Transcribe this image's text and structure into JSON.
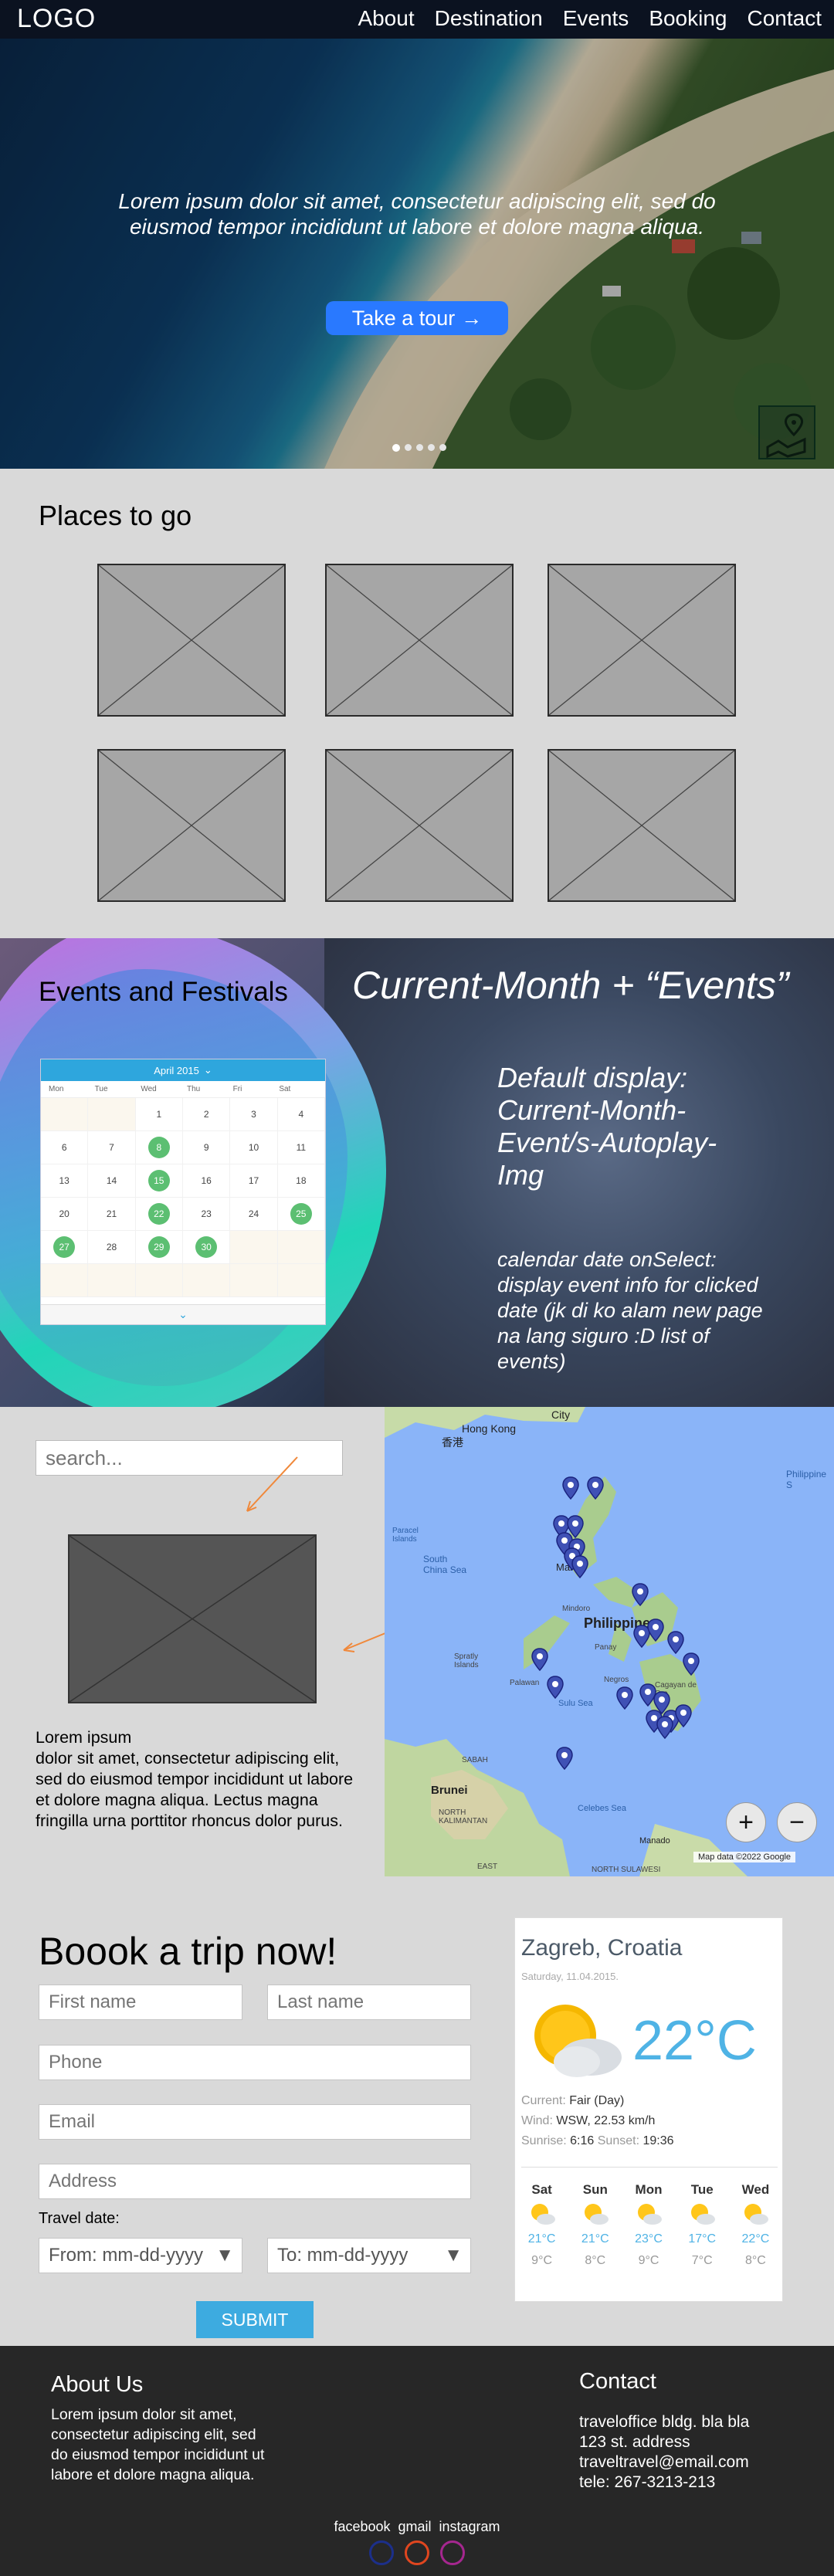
{
  "nav": {
    "logo": "LOGO",
    "links": [
      "About",
      "Destination",
      "Events",
      "Booking",
      "Contact"
    ]
  },
  "hero": {
    "text": "Lorem ipsum dolor sit amet, consectetur adipiscing elit, sed do eiusmod tempor incididunt ut labore et dolore magna aliqua.",
    "button_label": "Take a tour",
    "button_icon": "arrow-right-icon",
    "slide_count": 5,
    "active_slide": 1,
    "map_button_icon": "map-location-icon"
  },
  "places": {
    "title": "Places to go",
    "tile_count": 6
  },
  "events": {
    "title": "Events and Festivals",
    "month_heading": "Current-Month + “Events”",
    "default_display": "Default display: Current-Month-Event/s-Autoplay-Img",
    "calendar_note": "calendar date onSelect: display event info for clicked date (jk di ko alam new page na lang siguro :D list of events)",
    "calendar": {
      "header": "April 2015",
      "weekdays": [
        "Mon",
        "Tue",
        "Wed",
        "Thu",
        "Fri",
        "Sat"
      ],
      "weeks": [
        [
          "",
          "",
          "1",
          "2",
          "3",
          "4"
        ],
        [
          "6",
          "7",
          "8",
          "9",
          "10",
          "11"
        ],
        [
          "13",
          "14",
          "15",
          "16",
          "17",
          "18"
        ],
        [
          "20",
          "21",
          "22",
          "23",
          "24",
          "25"
        ],
        [
          "27",
          "28",
          "29",
          "30",
          "",
          ""
        ],
        [
          "",
          "",
          "",
          "",
          "",
          ""
        ]
      ],
      "highlighted": [
        "8",
        "15",
        "22",
        "25",
        "27",
        "29",
        "30"
      ],
      "accent_color": "#5cbf72",
      "header_color": "#2ea6dd"
    }
  },
  "map_section": {
    "search_placeholder": "search...",
    "info_text": "Lorem ipsum\ndolor sit amet, consectetur adipiscing elit, sed do eiusmod tempor incididunt ut labore et dolore magna aliqua. Lectus magna fringilla urna porttitor rhoncus dolor purus.",
    "map_labels": {
      "hong_kong": "Hong Kong",
      "hong_kong_cn": "香港",
      "city": "City",
      "paracel": "Paracel Islands",
      "scs": "South China Sea",
      "manila": "Manila",
      "philippines": "Philippines",
      "philippine_sea": "Philippine S",
      "mindoro": "Mindoro",
      "panay": "Panay",
      "spratly": "Spratly Islands",
      "palawan": "Palawan",
      "negros": "Negros",
      "cagayan": "Cagayan de Oro",
      "sulu": "Sulu Sea",
      "sabah": "SABAH",
      "brunei": "Brunei",
      "north_kalimantan": "NORTH KALIMANTAN",
      "celebes": "Celebes Sea",
      "manado": "Manado",
      "east": "EAST",
      "north_sulawesi": "NORTH SULAWESI",
      "attribution": "Map data ©2022 Google"
    },
    "zoom_in": "+",
    "zoom_out": "−"
  },
  "booking": {
    "title": "Boook a trip now!",
    "first_name": "First name",
    "last_name": "Last name",
    "phone": "Phone",
    "email": "Email",
    "address": "Address",
    "travel_date_label": "Travel date:",
    "from_placeholder": "From: mm-dd-yyyy",
    "to_placeholder": "To: mm-dd-yyyy",
    "submit_label": "SUBMIT"
  },
  "weather": {
    "city": "Zagreb, Croatia",
    "date": "Saturday, 11.04.2015.",
    "temperature": "22°C",
    "current_label": "Current:",
    "current_value": "Fair (Day)",
    "wind_label": "Wind:",
    "wind_value": "WSW, 22.53 km/h",
    "sunrise_label": "Sunrise:",
    "sunrise_value": "6:16",
    "sunset_label": "Sunset:",
    "sunset_value": "19:36",
    "icon": "sun-cloud-icon",
    "forecast": [
      {
        "day": "Sat",
        "hi": "21°C",
        "lo": "9°C"
      },
      {
        "day": "Sun",
        "hi": "21°C",
        "lo": "8°C"
      },
      {
        "day": "Mon",
        "hi": "23°C",
        "lo": "9°C"
      },
      {
        "day": "Tue",
        "hi": "17°C",
        "lo": "7°C"
      },
      {
        "day": "Wed",
        "hi": "22°C",
        "lo": "8°C"
      }
    ]
  },
  "footer": {
    "about_title": "About Us",
    "about_text": "Lorem ipsum dolor sit amet, consectetur adipiscing elit, sed do eiusmod tempor incididunt ut labore et dolore magna aliqua.",
    "contact_title": "Contact",
    "contact_lines": [
      "traveloffice bldg. bla bla",
      "123 st. address",
      "traveltravel@email.com",
      "tele: 267-3213-213"
    ],
    "social": [
      "facebook",
      "gmail",
      "instagram"
    ],
    "social_colors": [
      "#1c2f8a",
      "#e0461f",
      "#a5278f"
    ]
  }
}
